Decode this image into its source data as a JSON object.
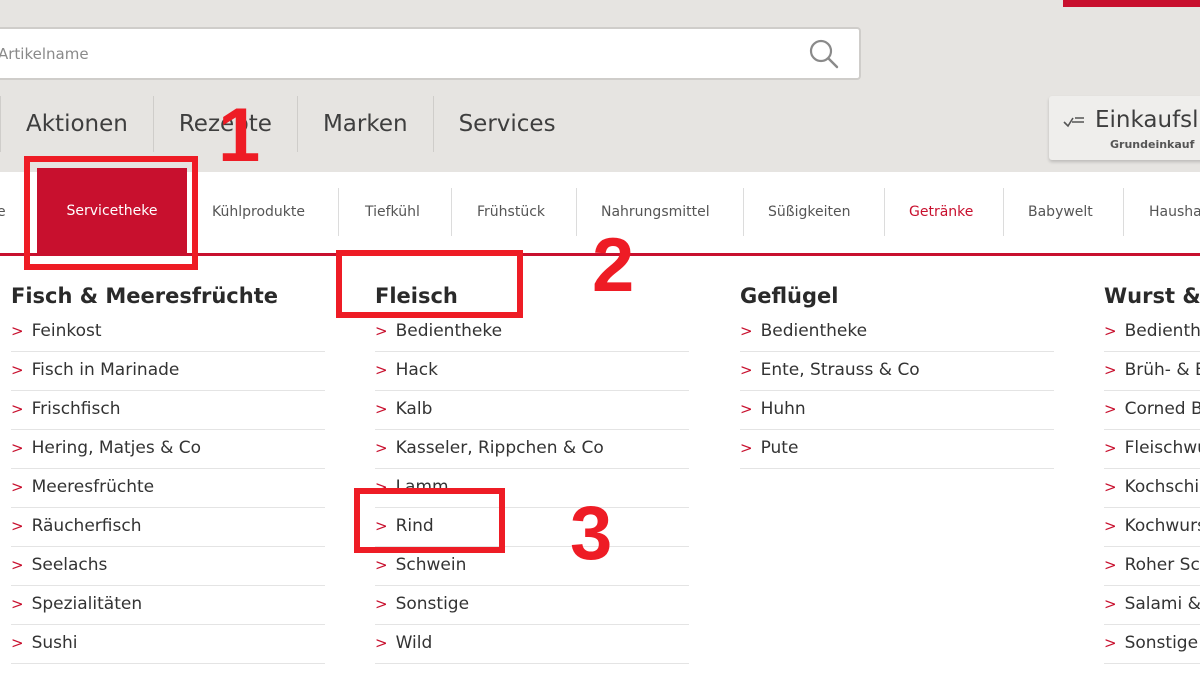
{
  "search": {
    "placeholder": "Artikelname"
  },
  "main_nav": [
    "Aktionen",
    "Rezepte",
    "Marken",
    "Services"
  ],
  "shopping_list": {
    "title": "Einkaufsliste",
    "subtitle": "Grundeinkauf"
  },
  "categories": {
    "partial_left": "e",
    "active": "Servicetheke",
    "items": [
      "Kühlprodukte",
      "Tiefkühl",
      "Frühstück",
      "Nahrungsmittel",
      "Süßigkeiten",
      "Getränke",
      "Babywelt",
      "Haushalt"
    ]
  },
  "columns": [
    {
      "heading": "Fisch & Meeresfrüchte",
      "items": [
        "Feinkost",
        "Fisch in Marinade",
        "Frischfisch",
        "Hering, Matjes & Co",
        "Meeresfrüchte",
        "Räucherfisch",
        "Seelachs",
        "Spezialitäten",
        "Sushi"
      ]
    },
    {
      "heading": "Fleisch",
      "items": [
        "Bedientheke",
        "Hack",
        "Kalb",
        "Kasseler, Rippchen & Co",
        "Lamm",
        "Rind",
        "Schwein",
        "Sonstige",
        "Wild"
      ]
    },
    {
      "heading": "Geflügel",
      "items": [
        "Bedientheke",
        "Ente, Strauss & Co",
        "Huhn",
        "Pute"
      ]
    },
    {
      "heading": "Wurst & Aufschnitt",
      "items": [
        "Bedientheke",
        "Brüh- & Bratwurst",
        "Corned Beef",
        "Fleischwurst",
        "Kochschinken",
        "Kochwurst",
        "Roher Schinken",
        "Salami & Co",
        "Sonstige"
      ]
    }
  ],
  "annotations": [
    "1",
    "2",
    "3"
  ],
  "chevron": ">",
  "colors": {
    "brand_red": "#c8102e",
    "annotation_red": "#ee1c25"
  }
}
